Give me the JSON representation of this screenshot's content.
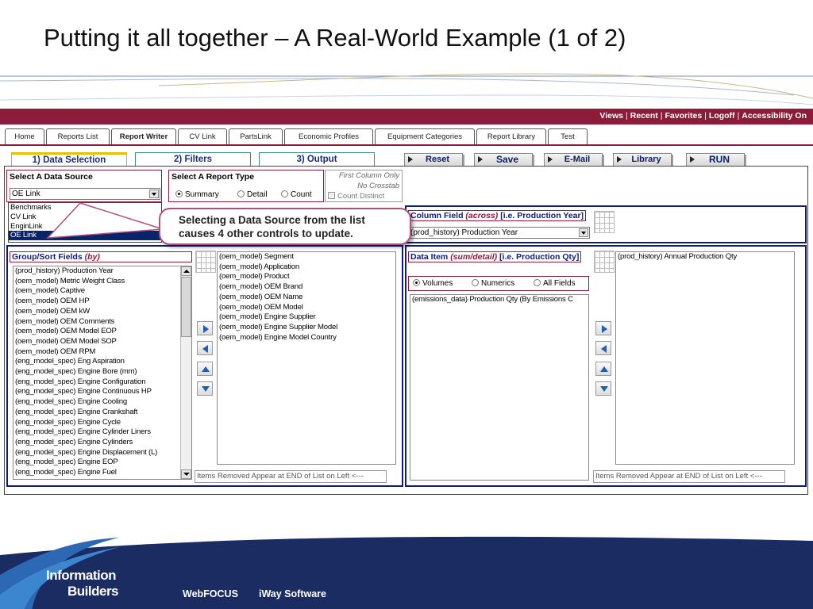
{
  "slide": {
    "title": "Putting it all together – A Real-World Example (1 of 2)"
  },
  "topbar": {
    "links": [
      "Views",
      "Recent",
      "Favorites",
      "Logoff",
      "Accessibility On"
    ],
    "separator": "|"
  },
  "tabs": [
    "Home",
    "Reports List",
    "Report Writer",
    "CV Link",
    "PartsLink",
    "Economic Profiles",
    "Equipment Categories",
    "Report Library",
    "Test"
  ],
  "active_tab": "Report Writer",
  "subtabs": [
    "1) Data Selection",
    "2) Filters",
    "3) Output"
  ],
  "active_subtab": "1) Data Selection",
  "buttons": {
    "reset": "Reset",
    "save": "Save",
    "email": "E-Mail",
    "library": "Library",
    "run": "RUN"
  },
  "data_source": {
    "header": "Select A Data Source",
    "selected": "OE Link",
    "options": [
      "Benchmarks",
      "CV Link",
      "EnginLink",
      "OE Link"
    ]
  },
  "report_type": {
    "header": "Select A Report Type",
    "options": [
      "Summary",
      "Detail",
      "Count"
    ],
    "selected": "Summary"
  },
  "first_column": {
    "line1": "First Column Only",
    "line2": "No Crosstab",
    "count_distinct": "Count Distinct"
  },
  "callout": {
    "line1": "Selecting a Data Source from the list",
    "line2": "causes 4 other controls to update."
  },
  "column_field": {
    "header_prefix": "Column Field ",
    "header_em": "(across)",
    "header_suffix": " [i.e. Production Year]",
    "selected": "(prod_history) Production Year"
  },
  "group_sort": {
    "header_prefix": "Group/Sort Fields ",
    "header_em": "(by)",
    "available": [
      "(prod_history) Production Year",
      "(oem_model) Metric Weight Class",
      "(oem_model) Captive",
      "(oem_model) OEM HP",
      "(oem_model) OEM kW",
      "(oem_model) OEM Comments",
      "(oem_model) OEM Model EOP",
      "(oem_model) OEM Model SOP",
      "(oem_model) OEM RPM",
      "(eng_model_spec) Eng Aspiration",
      "(eng_model_spec) Engine Bore (mm)",
      "(eng_model_spec) Engine Configuration",
      "(eng_model_spec) Engine Continuous HP",
      "(eng_model_spec) Engine Cooling",
      "(eng_model_spec) Engine Crankshaft",
      "(eng_model_spec) Engine Cycle",
      "(eng_model_spec) Engine Cylinder Liners",
      "(eng_model_spec) Engine Cylinders",
      "(eng_model_spec) Engine Displacement (L)",
      "(eng_model_spec) Engine EOP",
      "(eng_model_spec) Engine Fuel"
    ],
    "selected": [
      "(oem_model) Segment",
      "(oem_model) Application",
      "(oem_model) Product",
      "(oem_model) OEM Brand",
      "(oem_model) OEM Name",
      "(oem_model) OEM Model",
      "(oem_model) Engine Supplier",
      "(oem_model) Engine Supplier Model",
      "(oem_model) Engine Model Country"
    ],
    "removed_note": "Items Removed Appear at END of List on Left <---"
  },
  "data_item": {
    "header_prefix": "Data Item ",
    "header_em": "(sum/detail)",
    "header_suffix": " [i.e. Production Qty]",
    "filter_options": [
      "Volumes",
      "Numerics",
      "All Fields"
    ],
    "filter_selected": "Volumes",
    "available": [
      "(emissions_data) Production Qty (By Emissions C"
    ],
    "selected": [
      "(prod_history) Annual Production Qty"
    ],
    "removed_note": "Items Removed Appear at END of List on Left <---"
  },
  "footer": {
    "logo_line1": "Information",
    "logo_line2": "Builders",
    "product1": "WebFOCUS",
    "product2": "iWay Software"
  },
  "colors": {
    "accent": "#8c1c3a",
    "navy": "#1b2c63",
    "header_blue": "#0f1c77"
  }
}
